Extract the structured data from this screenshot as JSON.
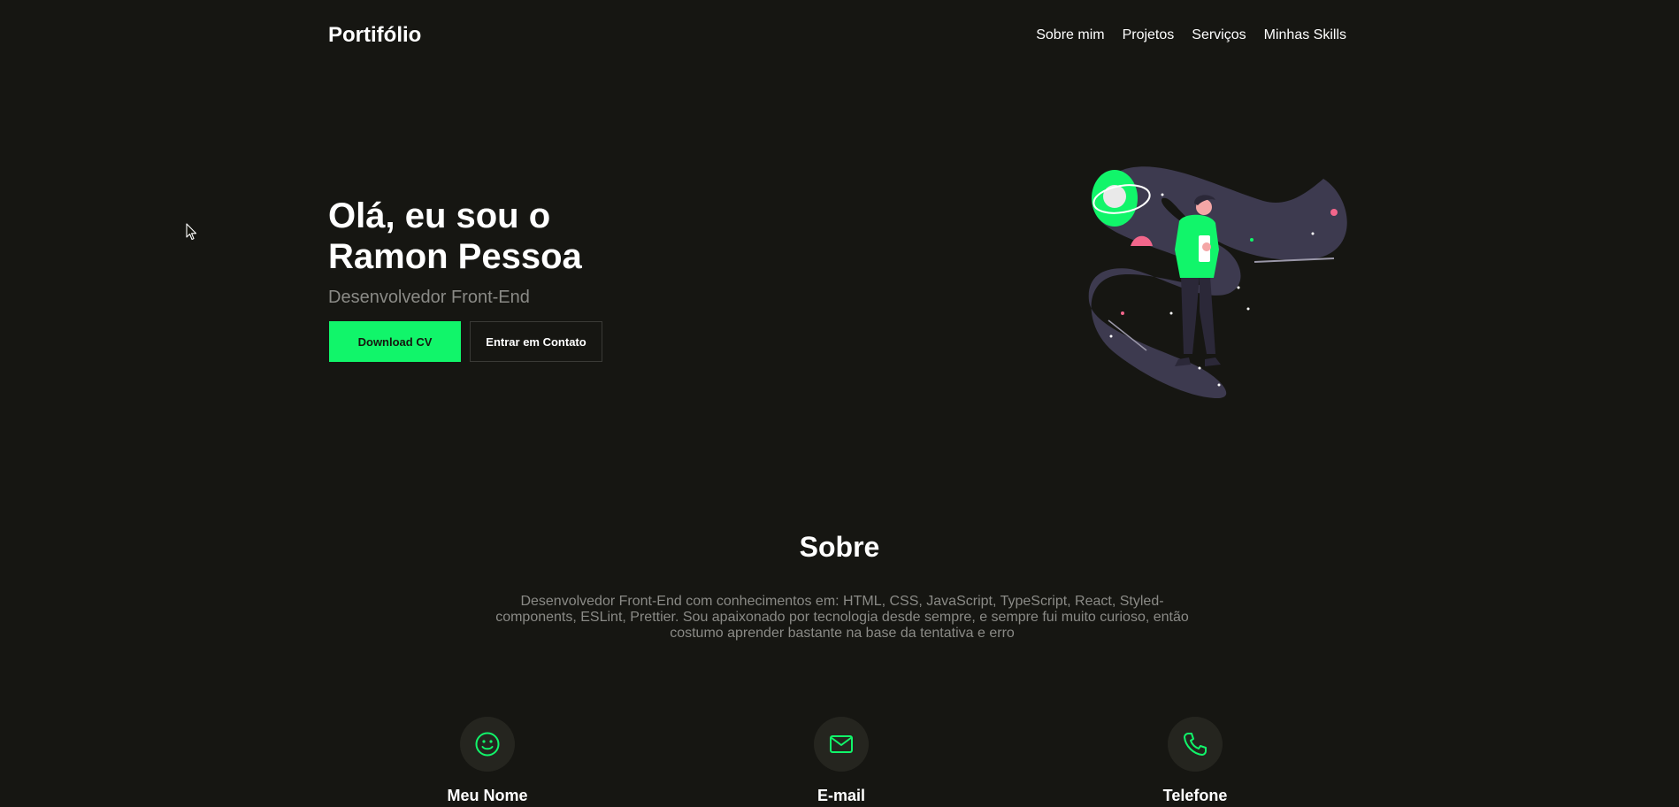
{
  "header": {
    "logo": "Portifólio",
    "nav": [
      "Sobre mim",
      "Projetos",
      "Serviços",
      "Minhas Skills"
    ]
  },
  "hero": {
    "title_line1": "Olá, eu sou o",
    "title_line2": "Ramon Pessoa",
    "subtitle": "Desenvolvedor Front-End",
    "primary_button": "Download CV",
    "secondary_button": "Entrar em Contato"
  },
  "about": {
    "title": "Sobre",
    "text": "Desenvolvedor Front-End com conhecimentos em: HTML, CSS, JavaScript, TypeScript, React, Styled-components, ESLint, Prettier. Sou apaixonado por tecnologia desde sempre, e sempre fui muito curioso, então costumo aprender bastante na base da tentativa e erro"
  },
  "contact_cards": [
    {
      "label": "Meu Nome",
      "icon": "smile-icon"
    },
    {
      "label": "E-mail",
      "icon": "mail-icon"
    },
    {
      "label": "Telefone",
      "icon": "phone-icon"
    }
  ],
  "colors": {
    "background": "#161612",
    "accent": "#11f56a",
    "muted_text": "#8a8a86",
    "icon_bg": "#25251f"
  }
}
